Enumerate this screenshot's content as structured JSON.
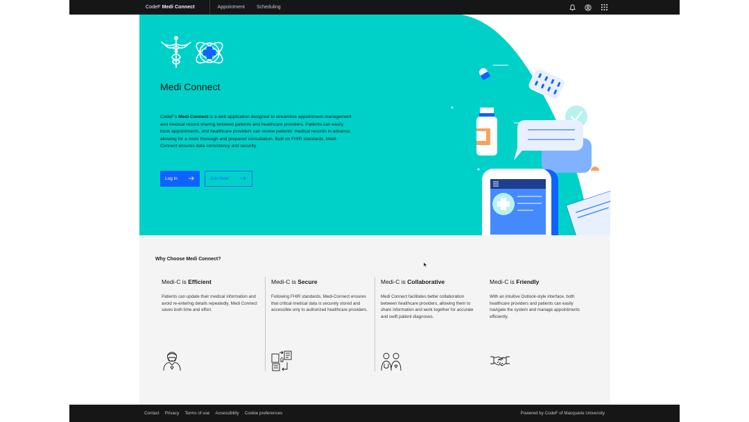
{
  "header": {
    "brand_prefix": "CodeF",
    "brand_name": "Medi Connect",
    "nav": [
      "Appointment",
      "Scheduling"
    ],
    "icons": [
      "notification-icon",
      "user-avatar-icon",
      "app-switcher-icon"
    ]
  },
  "hero": {
    "title": "Medi Connect",
    "desc_prefix": "CodeF's",
    "desc_brand": "Medi Connect",
    "desc_body": " is a web application designed to streamline appointment management and medical record sharing between patients and healthcare providers. Patients can easily book appointments, and healthcare providers can review patients' medical records in advance, allowing for a more thorough and prepared consultation. Built on FHIR standards, Medi-Connect ensures data consistency and security.",
    "login_label": "Log in",
    "join_label": "Join Now"
  },
  "why": {
    "heading": "Why Choose Medi Connect?",
    "cards": [
      {
        "prefix": "Medi-C is ",
        "bold": "Efficient",
        "text": "Patients can update their medical information and avoid re-entering details repeatedly. Medi Connect saves both time and effort."
      },
      {
        "prefix": "Medi-C is ",
        "bold": "Secure",
        "text": "Following FHIR standards, Medi-Connect ensures that critical medical data is securely stored and accessible only to authorized healthcare providers."
      },
      {
        "prefix": "Medi-C is ",
        "bold": "Collaborative",
        "text": "Medi Connect facilitates better collaboration between healthcare providers, allowing them to share information and work together for accurate and swift patient diagnoses."
      },
      {
        "prefix": "Medi-C is ",
        "bold": "Friendly",
        "text": "With an intuitive Outlook-style interface, both healthcare providers and patients can easily navigate the system and manage appointments efficiently."
      }
    ]
  },
  "footer": {
    "links": [
      "Contact",
      "Privacy",
      "Terms of use",
      "Accessibility",
      "Cookie preferences"
    ],
    "credit": "Powered by CodeF of Macquarie University"
  },
  "colors": {
    "teal": "#00d1c8",
    "primary_blue": "#0f62fe",
    "dark": "#161616",
    "section_bg": "#f4f4f4"
  }
}
